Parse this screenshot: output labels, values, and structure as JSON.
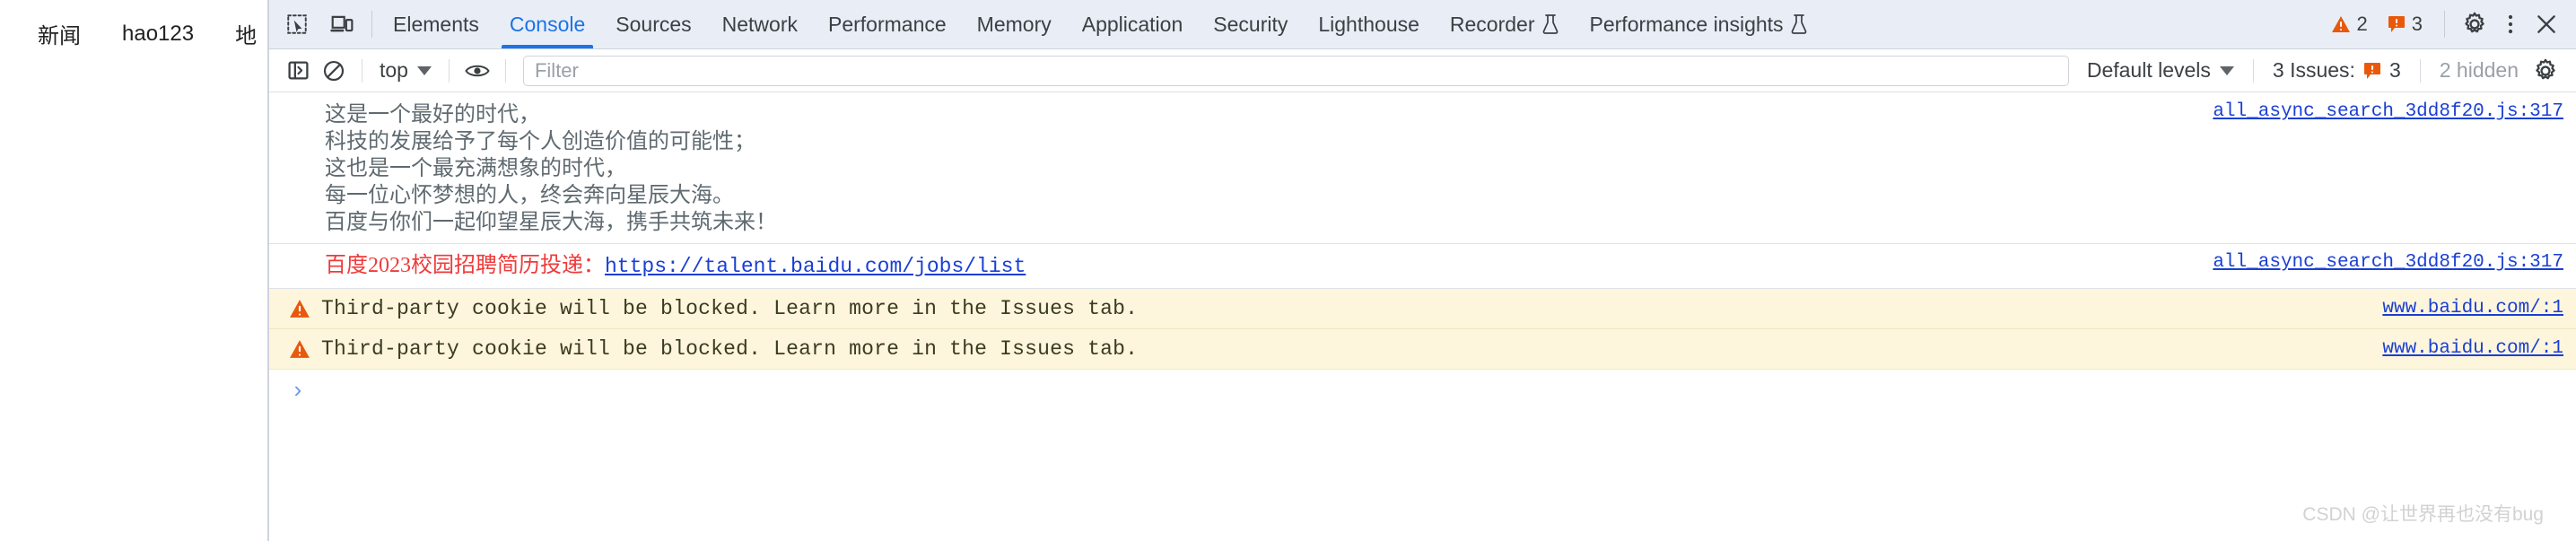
{
  "page_behind": {
    "nav_items": [
      {
        "label": "新闻"
      },
      {
        "label": "hao123"
      },
      {
        "label": "地"
      }
    ]
  },
  "devtools": {
    "toolbar": {
      "inspect_icon": "inspect-element-icon",
      "device_icon": "device-toolbar-icon",
      "tabs": [
        {
          "label": "Elements",
          "active": false,
          "experimental": false
        },
        {
          "label": "Console",
          "active": true,
          "experimental": false
        },
        {
          "label": "Sources",
          "active": false,
          "experimental": false
        },
        {
          "label": "Network",
          "active": false,
          "experimental": false
        },
        {
          "label": "Performance",
          "active": false,
          "experimental": false
        },
        {
          "label": "Memory",
          "active": false,
          "experimental": false
        },
        {
          "label": "Application",
          "active": false,
          "experimental": false
        },
        {
          "label": "Security",
          "active": false,
          "experimental": false
        },
        {
          "label": "Lighthouse",
          "active": false,
          "experimental": false
        },
        {
          "label": "Recorder",
          "active": false,
          "experimental": true
        },
        {
          "label": "Performance insights",
          "active": false,
          "experimental": true
        }
      ],
      "warning_count": "2",
      "error_count": "3",
      "settings_icon": "gear-icon",
      "more_icon": "kebab-menu-icon",
      "close_icon": "close-icon"
    },
    "filterbar": {
      "sidebar_toggle_icon": "console-sidebar-icon",
      "clear_console_icon": "clear-console-icon",
      "context_value": "top",
      "live_expression_icon": "eye-icon",
      "filter_placeholder": "Filter",
      "filter_value": "",
      "levels_value": "Default levels",
      "issues_label": "3 Issues:",
      "issues_count": "3",
      "hidden_label": "2 hidden",
      "settings_icon": "gear-icon"
    },
    "messages": [
      {
        "type": "log",
        "text": "这是一个最好的时代，\n科技的发展给予了每个人创造价值的可能性；\n这也是一个最充满想象的时代，\n每一位心怀梦想的人，终会奔向星辰大海。\n百度与你们一起仰望星辰大海，携手共筑未来！",
        "source": "all_async_search_3dd8f20.js:317"
      },
      {
        "type": "log-link",
        "text": "百度2023校园招聘简历投递：",
        "link": "https://talent.baidu.com/jobs/list",
        "source": "all_async_search_3dd8f20.js:317"
      },
      {
        "type": "warning",
        "icon": "warning-triangle-icon",
        "text": "Third-party cookie will be blocked. Learn more in the Issues tab.",
        "source": "www.baidu.com/:1"
      },
      {
        "type": "warning",
        "icon": "warning-triangle-icon",
        "text": "Third-party cookie will be blocked. Learn more in the Issues tab.",
        "source": "www.baidu.com/:1"
      }
    ],
    "prompt": {
      "chevron": "›",
      "value": ""
    }
  },
  "watermark": "CSDN @让世界再也没有bug",
  "colors": {
    "accent": "#1a73e8",
    "toolbar_bg": "#e9eef6",
    "warning_bg": "#fdf6dd",
    "warning_icon": "#e8590c",
    "link": "#1a3fd4",
    "error_text": "#ee3b3b"
  }
}
